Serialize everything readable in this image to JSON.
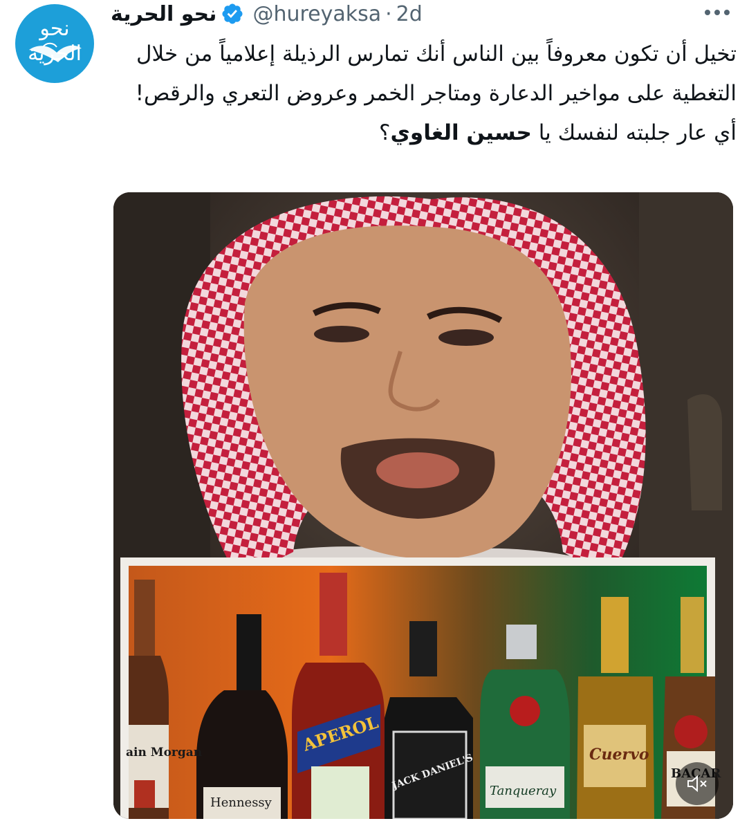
{
  "account": {
    "display_name": "نحو الحرية",
    "handle": "@hureyaksa",
    "separator": "·",
    "time": "2d",
    "avatar_text": "نحو الحرية",
    "verified_icon": "verified-badge-icon",
    "more_icon": "more-options-icon"
  },
  "tweet": {
    "text_main": "تخيل أن تكون معروفاً بين الناس أنك تمارس الرذيلة إعلامياً من خلال التغطية على مواخير الدعارة ومتاجر الخمر وعروض التعري والرقص! أي عار جلبته لنفسك يا ",
    "text_bold": "حسين الغاوي",
    "text_end": "؟"
  },
  "media": {
    "type": "video",
    "mute_icon": "speaker-muted-icon",
    "bottle_labels": {
      "captain_morgan": "ain Morgan",
      "hennessy": "Hennessy",
      "aperol": "APEROL",
      "jack_daniels": "JACK DANIEL'S",
      "tanqueray": "Tanqueray",
      "cuervo": "Cuervo",
      "bacardi": "BACAR"
    }
  },
  "colors": {
    "brand_blue": "#1d9bf0",
    "avatar_bg": "#1d9fd9",
    "text": "#0f1419",
    "secondary_text": "#536471"
  }
}
